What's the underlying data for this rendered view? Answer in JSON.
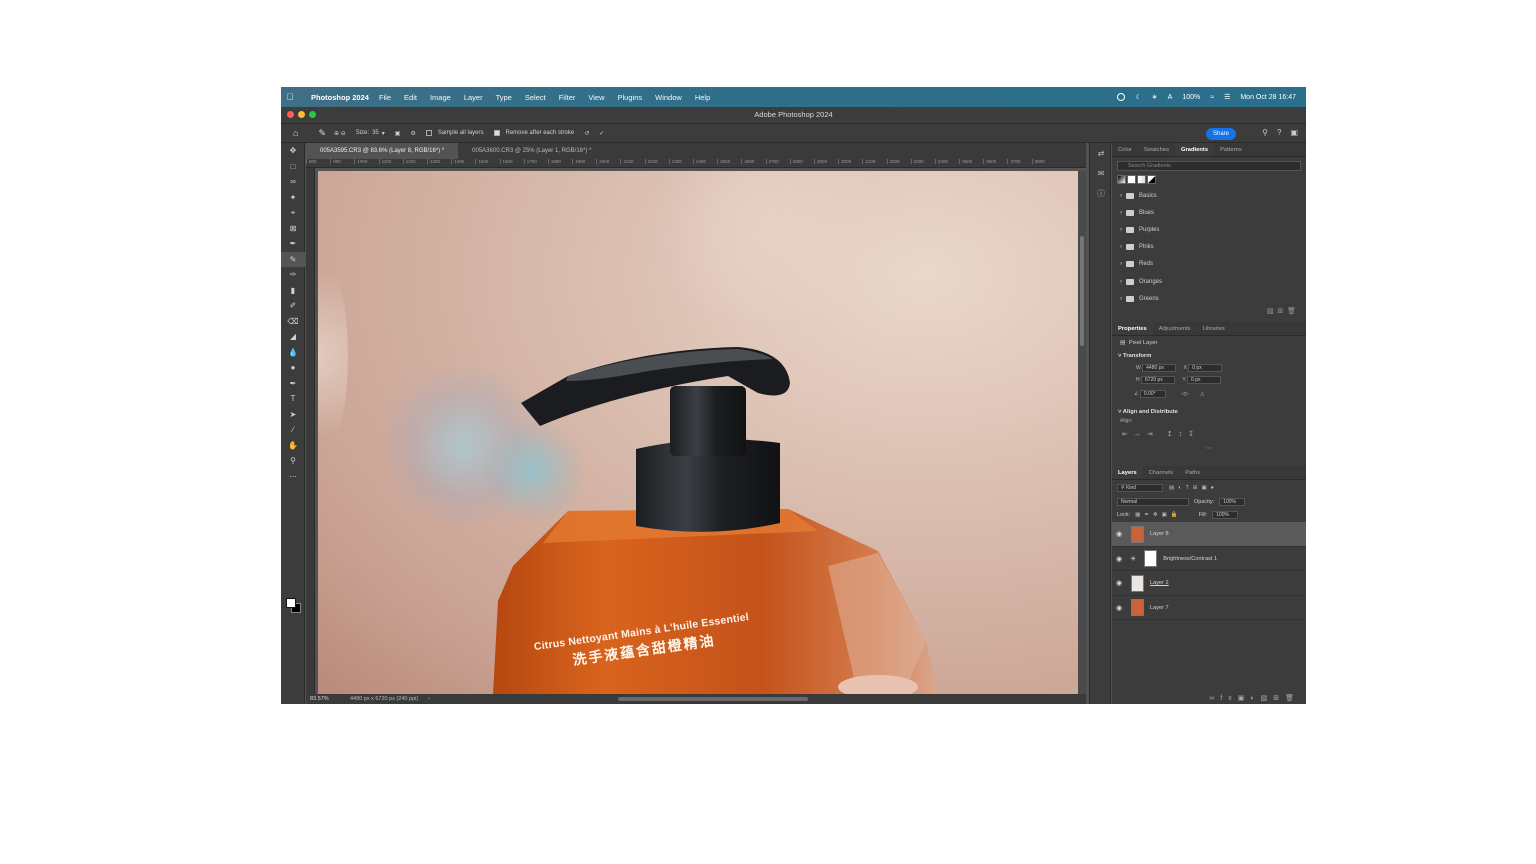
{
  "menubar": {
    "app_name": "Photoshop 2024",
    "items": [
      "File",
      "Edit",
      "Image",
      "Layer",
      "Type",
      "Select",
      "Filter",
      "View",
      "Plugins",
      "Window",
      "Help"
    ],
    "battery": "100%",
    "clock": "Mon Oct 28  16:47"
  },
  "window": {
    "title": "Adobe Photoshop 2024"
  },
  "options": {
    "size_label": "Size:",
    "size_value": "35",
    "sample_all_layers": "Sample all layers",
    "remove_after_stroke": "Remove after each stroke",
    "share_label": "Share"
  },
  "documents": {
    "tabs": [
      {
        "label": "005A3595.CR3 @ 83.6% (Layer 8, RGB/16*) *",
        "active": true
      },
      {
        "label": "005A3600.CR3 @ 25% (Layer 1, RGB/16*) *",
        "active": false
      }
    ]
  },
  "ruler": {
    "ticks": [
      "800",
      "900",
      "1000",
      "1100",
      "1200",
      "1300",
      "1400",
      "1500",
      "1600",
      "1700",
      "1800",
      "1900",
      "2000",
      "2100",
      "2200",
      "2300",
      "2400",
      "2500",
      "2600",
      "2700",
      "2800",
      "2900",
      "3000",
      "3100",
      "3200",
      "3300",
      "3400",
      "3500",
      "3600",
      "3700",
      "3800"
    ]
  },
  "canvas": {
    "label_line1": "Citrus Nettoyant Mains à L'huile Essentiel",
    "label_line2": "洗手液蕴含甜橙精油"
  },
  "status": {
    "zoom": "83.57%",
    "doc_size": "4480 px x 6720 px (240 ppi)"
  },
  "gradients_panel": {
    "tabs": [
      "Color",
      "Swatches",
      "Gradients",
      "Patterns"
    ],
    "active_tab": "Gradients",
    "search_placeholder": "Search Gradients",
    "folders": [
      "Basics",
      "Blues",
      "Purples",
      "Pinks",
      "Reds",
      "Oranges",
      "Greens"
    ]
  },
  "properties_panel": {
    "tabs": [
      "Properties",
      "Adjustments",
      "Libraries"
    ],
    "active_tab": "Properties",
    "kind": "Pixel Layer",
    "transform_title": "Transform",
    "w_label": "W",
    "w_value": "4480 px",
    "h_label": "H",
    "h_value": "6720 px",
    "x_label": "X",
    "x_value": "0 px",
    "y_label": "Y",
    "y_value": "0 px",
    "angle_value": "0.00°",
    "align_title": "Align and Distribute",
    "align_label": "Align:"
  },
  "layers_panel": {
    "tabs": [
      "Layers",
      "Channels",
      "Paths"
    ],
    "active_tab": "Layers",
    "filter_label": "Kind",
    "blend_mode": "Normal",
    "opacity_label": "Opacity:",
    "opacity_value": "100%",
    "lock_label": "Lock:",
    "fill_label": "Fill:",
    "fill_value": "100%",
    "layers": [
      {
        "name": "Layer 8",
        "selected": true,
        "thumb_color": "#c8643a"
      },
      {
        "name": "Brightness/Contrast 1",
        "selected": false,
        "thumb_color": "#ffffff"
      },
      {
        "name": "Layer 2",
        "selected": false,
        "thumb_color": "#e9e6e4"
      },
      {
        "name": "Layer 7",
        "selected": false,
        "thumb_color": "#c8643a"
      }
    ]
  },
  "colors": {
    "accent": "#1473e6",
    "foreground": "#ffffff",
    "background": "#000000"
  }
}
